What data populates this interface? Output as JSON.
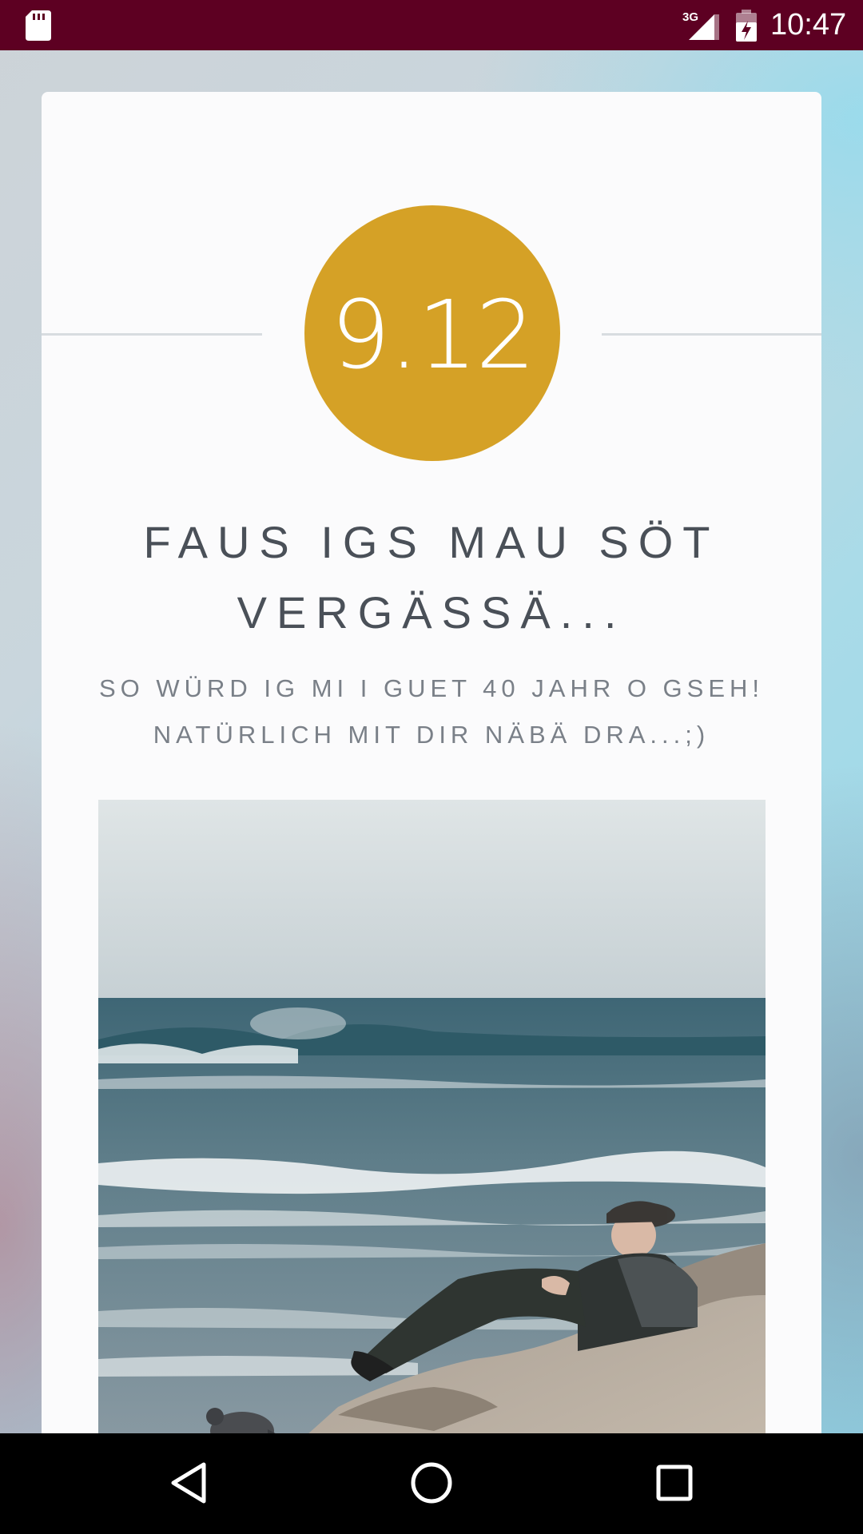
{
  "status_bar": {
    "time": "10:47",
    "network_type": "3G",
    "icons": [
      "sd-card-icon",
      "signal-icon",
      "battery-icon"
    ],
    "background_color": "#5d0022"
  },
  "card": {
    "date_badge": {
      "text": "9.12",
      "color": "#d5a126"
    },
    "headline": "FAUS IGS MAU SÖT VERGÄSSÄ...",
    "subline": "SO WÜRD IG MI I GUET 40 JAHR O GSEH! NATÜRLICH MIT DIR NÄBÄ DRA...;)",
    "photo": {
      "subject": "elderly man in a cap lying on a rocky beach by the sea, a pigeon in the foreground"
    }
  },
  "nav_bar": {
    "buttons": [
      "back-icon",
      "home-icon",
      "recents-icon"
    ]
  }
}
